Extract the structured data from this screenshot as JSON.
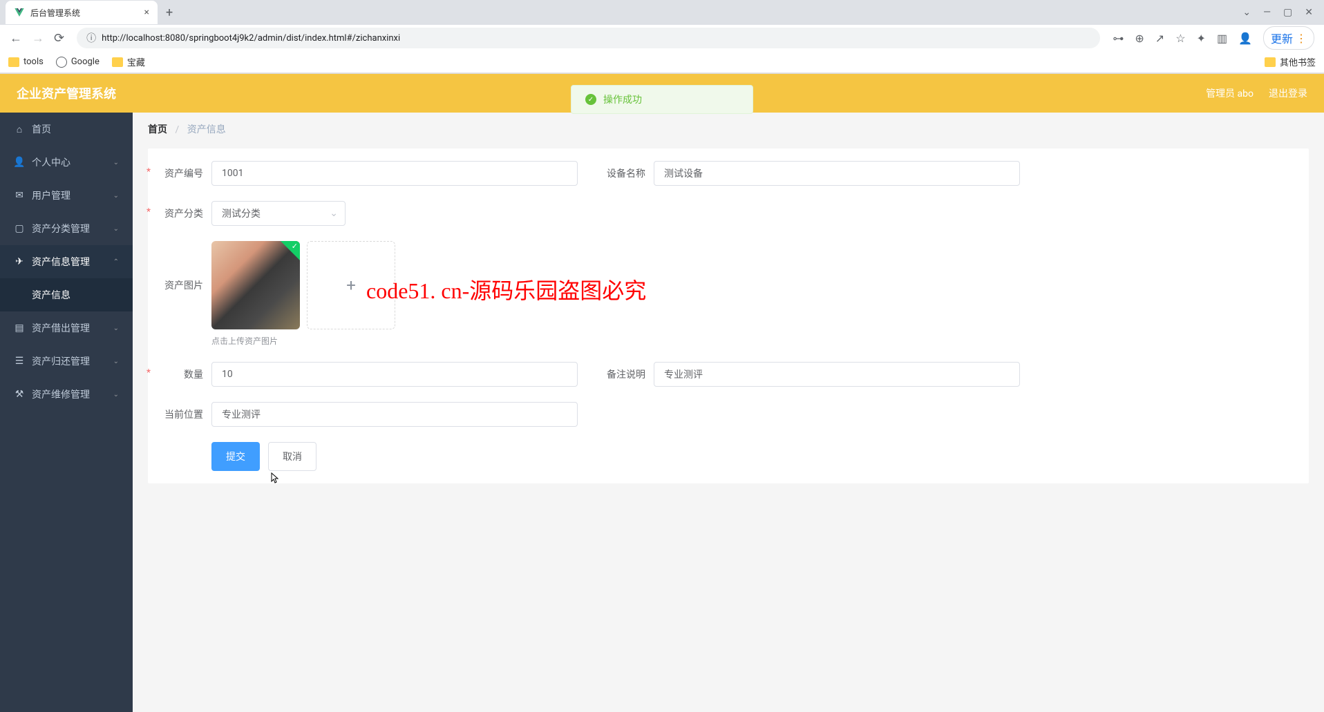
{
  "browser": {
    "tab_title": "后台管理系统",
    "url": "http://localhost:8080/springboot4j9k2/admin/dist/index.html#/zichanxinxi",
    "update_label": "更新",
    "bookmarks": {
      "tools": "tools",
      "google": "Google",
      "treasure": "宝藏",
      "other": "其他书签"
    }
  },
  "header": {
    "app_title": "企业资产管理系统",
    "user_label": "管理员 abo",
    "logout_label": "退出登录",
    "toast": "操作成功"
  },
  "sidebar": {
    "items": {
      "home": "首页",
      "profile": "个人中心",
      "user": "用户管理",
      "category": "资产分类管理",
      "asset_info": "资产信息管理",
      "asset_info_sub": "资产信息",
      "lend": "资产借出管理",
      "return": "资产归还管理",
      "repair": "资产维修管理"
    }
  },
  "breadcrumb": {
    "home": "首页",
    "sep": "/",
    "current": "资产信息"
  },
  "form": {
    "labels": {
      "asset_no": "资产编号",
      "device_name": "设备名称",
      "category": "资产分类",
      "image": "资产图片",
      "upload_tip": "点击上传资产图片",
      "quantity": "数量",
      "remark": "备注说明",
      "location": "当前位置"
    },
    "values": {
      "asset_no": "1001",
      "device_name": "测试设备",
      "category": "测试分类",
      "quantity": "10",
      "remark": "专业测评",
      "location": "专业测评"
    },
    "buttons": {
      "submit": "提交",
      "cancel": "取消"
    }
  },
  "watermark": "code51. cn-源码乐园盗图必究"
}
